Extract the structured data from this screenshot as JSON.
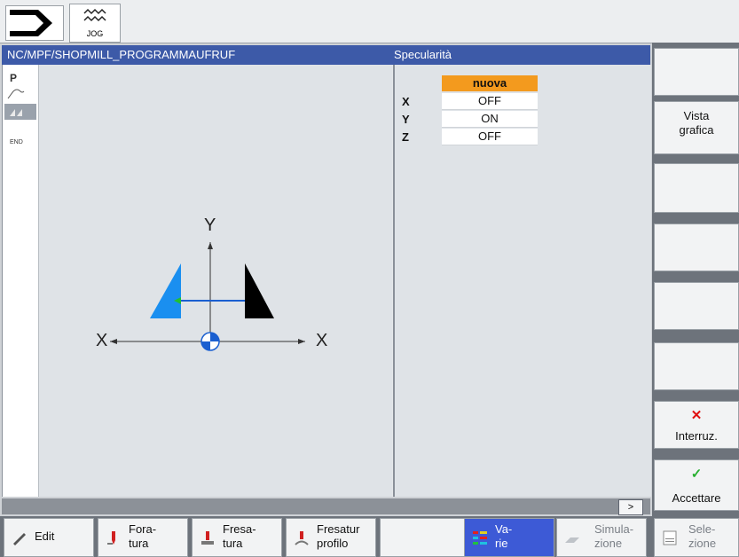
{
  "header": {
    "mode_label": "JOG"
  },
  "title": {
    "path": "NC/MPF/SHOPMILL_PROGRAMMAUFRUF",
    "function": "Specularità"
  },
  "program_strip": [
    "P",
    "END"
  ],
  "graphic": {
    "y_label": "Y",
    "x_left_label": "X",
    "x_right_label": "X"
  },
  "params": {
    "header": "nuova",
    "rows": [
      {
        "axis": "X",
        "value": "OFF"
      },
      {
        "axis": "Y",
        "value": "ON"
      },
      {
        "axis": "Z",
        "value": "OFF"
      }
    ]
  },
  "status": {
    "next_label": ">"
  },
  "vertical_softkeys": [
    {
      "label": ""
    },
    {
      "label_line1": "Vista",
      "label_line2": "grafica"
    },
    {
      "label": ""
    },
    {
      "label": ""
    },
    {
      "label": ""
    },
    {
      "label": ""
    },
    {
      "label": "Interruz."
    },
    {
      "label": "Accettare"
    }
  ],
  "horizontal_softkeys": [
    {
      "line1": "Edit",
      "line2": ""
    },
    {
      "line1": "Fora-",
      "line2": "tura"
    },
    {
      "line1": "Fresa-",
      "line2": "tura"
    },
    {
      "line1": "Fresatur",
      "line2": "profilo"
    },
    {
      "line1": "",
      "line2": ""
    },
    {
      "line1": "Va-",
      "line2": "rie"
    },
    {
      "line1": "Simula-",
      "line2": "zione"
    },
    {
      "line1": "Sele-",
      "line2": "zione"
    }
  ],
  "colors": {
    "title_bar": "#3d5aa8",
    "accent_orange": "#f39a1e",
    "active_softkey": "#3d5ad6",
    "mirror_blue": "#1a8ff0"
  }
}
